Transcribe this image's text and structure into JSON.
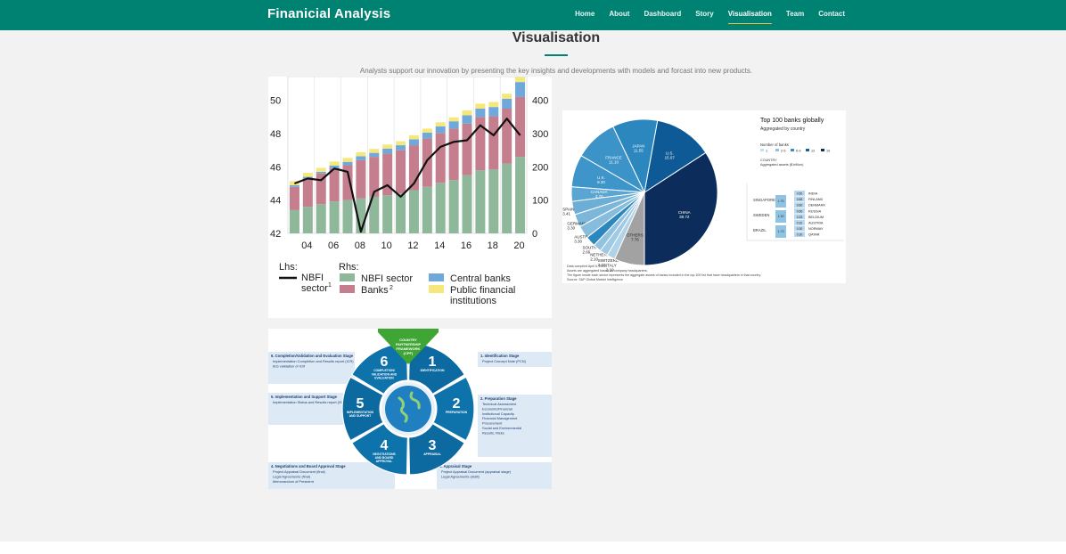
{
  "header": {
    "brand": "Finanicial Analysis",
    "nav": [
      {
        "label": "Home"
      },
      {
        "label": "About"
      },
      {
        "label": "Dashboard"
      },
      {
        "label": "Story"
      },
      {
        "label": "Visualisation",
        "active": true
      },
      {
        "label": "Team"
      },
      {
        "label": "Contact"
      }
    ]
  },
  "section": {
    "title": "Visualisation",
    "subtitle": "Analysts support our innovation by presenting the key insights and developments with models and forcast into new products."
  },
  "colors": {
    "brand": "#008272",
    "active_underline": "#f3c04e",
    "nbfi_sector": "#8fb89b",
    "banks": "#c47e8e",
    "central_banks": "#6fa9dc",
    "public_financial": "#f6e77a"
  },
  "chart_data": [
    {
      "type": "bar",
      "x": [
        "03",
        "04",
        "05",
        "06",
        "07",
        "08",
        "09",
        "10",
        "11",
        "12",
        "13",
        "14",
        "15",
        "16",
        "17",
        "18",
        "19",
        "20"
      ],
      "xticks": [
        "04",
        "06",
        "08",
        "10",
        "12",
        "14",
        "16",
        "18",
        "20"
      ],
      "left_ticks": [
        "50",
        "48",
        "46",
        "44",
        "42"
      ],
      "right_ticks": [
        "400",
        "300",
        "200",
        "100",
        "0"
      ],
      "ylim_left": [
        42,
        51
      ],
      "ylim_right": [
        0,
        450
      ],
      "series": [
        {
          "name": "NBFI sector",
          "axis": "right",
          "values": [
            70,
            80,
            88,
            96,
            100,
            105,
            110,
            115,
            120,
            130,
            140,
            152,
            160,
            175,
            190,
            192,
            210,
            230
          ]
        },
        {
          "name": "Banks",
          "axis": "right",
          "values": [
            70,
            85,
            92,
            100,
            105,
            115,
            120,
            125,
            130,
            135,
            145,
            150,
            155,
            155,
            160,
            160,
            165,
            180
          ]
        },
        {
          "name": "Central banks",
          "axis": "right",
          "values": [
            5,
            5,
            5,
            8,
            10,
            12,
            12,
            15,
            15,
            18,
            18,
            20,
            22,
            25,
            25,
            28,
            30,
            45
          ]
        },
        {
          "name": "Public financial institutions",
          "axis": "right",
          "values": [
            12,
            12,
            12,
            12,
            12,
            12,
            12,
            12,
            12,
            12,
            12,
            12,
            12,
            15,
            15,
            15,
            15,
            15
          ]
        },
        {
          "name": "NBFI sector",
          "axis": "left",
          "type": "line",
          "values": [
            45.0,
            45.3,
            45.2,
            45.9,
            45.7,
            42.1,
            44.5,
            44.9,
            44.2,
            45.0,
            46.4,
            47.2,
            47.5,
            47.6,
            48.5,
            47.9,
            48.9,
            47.9
          ]
        }
      ],
      "legend": {
        "lhs_label": "Lhs:",
        "rhs_label": "Rhs:",
        "items": [
          {
            "label": "NBFI",
            "label2": "sector",
            "sup": "1",
            "color": "#000000",
            "kind": "line"
          },
          {
            "label": "NBFI sector",
            "color": "#8fb89b",
            "kind": "box"
          },
          {
            "label": "Banks",
            "sup": "2",
            "color": "#c47e8e",
            "kind": "box"
          },
          {
            "label": "Central banks",
            "color": "#6fa9dc",
            "kind": "box"
          },
          {
            "label": "Public financial",
            "label2": "institutions",
            "color": "#f6e77a",
            "kind": "box"
          }
        ]
      },
      "grid": true
    },
    {
      "type": "pie",
      "title": "Top 100 banks globally",
      "subtitle": "Aggregated by country",
      "slices": [
        {
          "label": "CHINA",
          "value": 39.72,
          "color": "#0c2d5c"
        },
        {
          "label": "U.S.",
          "value": 15.07,
          "color": "#0d5a96"
        },
        {
          "label": "JAPAN",
          "value": 11.55,
          "color": "#2b87bd"
        },
        {
          "label": "FRANCE",
          "value": 11.1,
          "color": "#3b93c7"
        },
        {
          "label": "U.K.",
          "value": 8.3,
          "color": "#3d95c9"
        },
        {
          "label": "CANADA",
          "value": 3.76,
          "color": "#5aa5d2"
        },
        {
          "label": "SPAIN",
          "value": 3.41,
          "color": "#6daed6"
        },
        {
          "label": "GERMANY",
          "value": 3.3,
          "color": "#7cb7da"
        },
        {
          "label": "AUSTRALIA",
          "value": 3.3,
          "color": "#86bcdc"
        },
        {
          "label": "SOUTH KOREA",
          "value": 2.66,
          "color": "#2b87bd"
        },
        {
          "label": "NETHERLANDS",
          "value": 2.1,
          "color": "#91c2e0"
        },
        {
          "label": "SWITZERLAND",
          "value": 2.1,
          "color": "#a0c9e3"
        },
        {
          "label": "ITALY",
          "value": 2.1,
          "color": "#b1d3e8"
        },
        {
          "label": "OTHERS",
          "value": 7.76,
          "color": "#a2a2a2"
        }
      ],
      "legend_title": "Number of banks",
      "legend_counts": [
        "1",
        "2-5",
        "6-9",
        "12",
        "19"
      ],
      "legend_note": "Aggregated assets ($ trillion)",
      "country_label": "COUNTRY",
      "side_countries": [
        {
          "label": "SINGAPORE",
          "value": "1.75"
        },
        {
          "label": "SWEDEN",
          "value": "1.30"
        },
        {
          "label": "BRAZIL",
          "value": "1.73"
        }
      ],
      "small_countries": [
        {
          "label": "INDIA",
          "value": "0.50"
        },
        {
          "label": "FINLAND",
          "value": "0.65"
        },
        {
          "label": "DENMARK",
          "value": "0.60"
        },
        {
          "label": "RUSSIA",
          "value": "0.66"
        },
        {
          "label": "BELGIUM",
          "value": "0.33"
        },
        {
          "label": "AUSTRIA",
          "value": "0.32"
        },
        {
          "label": "NORWAY",
          "value": "0.30"
        },
        {
          "label": "QATAR",
          "value": "0.30"
        }
      ],
      "notes": [
        "Data compiled April 6, 2022.",
        "Assets are aggregated based on company headquarters.",
        "The figure inside each sector represents the aggregate assets of banks included in the top 100 list that have headquarters in that country.",
        "Source: S&P Global Market Intelligence"
      ]
    }
  ],
  "cycle": {
    "top_label": [
      "COUNTRY",
      "PARTNERSHIP",
      "FRAMEWORK",
      "(CPF)"
    ],
    "segments": [
      {
        "number": "1",
        "label": [
          "IDENTIFICATION"
        ]
      },
      {
        "number": "2",
        "label": [
          "PREPARATION"
        ]
      },
      {
        "number": "3",
        "label": [
          "APPRAISAL"
        ]
      },
      {
        "number": "4",
        "label": [
          "NEGOTIATIONS",
          "AND BOARD",
          "APPROVAL"
        ]
      },
      {
        "number": "5",
        "label": [
          "IMPLEMENTATION",
          "AND SUPPORT"
        ]
      },
      {
        "number": "6",
        "label": [
          "COMPLETION/",
          "VALIDATION AND",
          "EVALUATION"
        ]
      }
    ],
    "boxes": [
      {
        "title": "1. Identification Stage",
        "items": [
          "Project Concept Note (PCN)"
        ]
      },
      {
        "title": "2. Preparation Stage",
        "items": [
          "Technical Assessment",
          "Economic/Financial",
          "Institutional Capacity",
          "Financial Management",
          "Procurement",
          "Social and Environmental",
          "Results, Risks"
        ]
      },
      {
        "title": "3. Appraisal Stage",
        "items": [
          "Project Appraisal Document (appraisal stage)",
          "Legal Agreements (draft)"
        ]
      },
      {
        "title": "4. Negotiations and Board Approval Stage",
        "items": [
          "Project Appraisal Document (final)",
          "Legal Agreements (final)",
          "Memorandum of President"
        ]
      },
      {
        "title": "5. Implementation and Support Stage",
        "items": [
          "Implementation Status and Results report (ISR)"
        ]
      },
      {
        "title": "6. Completion/Validation and Evaluation Stage",
        "items": [
          "Implementation Completion and Results report (ICR)",
          "IEG validation of ICR"
        ]
      }
    ]
  }
}
